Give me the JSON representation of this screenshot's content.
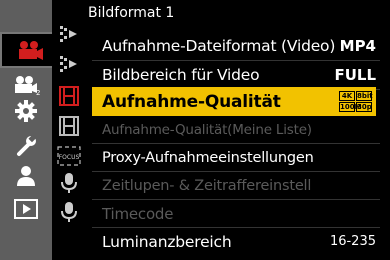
{
  "header": {
    "title": "Bildformat 1"
  },
  "menu": {
    "items": [
      {
        "label": "Aufnahme-Dateiformat (Video)",
        "value": "MP4"
      },
      {
        "label": "Bildbereich für Video",
        "value": "FULL"
      },
      {
        "label": "Aufnahme-Qualität",
        "badge": [
          "4K",
          "8bit",
          "100M",
          "30p"
        ]
      },
      {
        "label": "Aufnahme-Qualität(Meine Liste)"
      },
      {
        "label": "Proxy-Aufnahmeeinstellungen"
      },
      {
        "label": "Zeitlupen- & Zeitraffereinstell"
      },
      {
        "label": "Timecode"
      },
      {
        "label": "Luminanzbereich",
        "value": "16-235"
      }
    ]
  },
  "subtabs": {
    "focus_label": "FOCUS"
  },
  "colors": {
    "highlight": "#f2c200",
    "active_tab": "#d21e1e",
    "sidebar": "#5e5e5e"
  },
  "icons": {
    "main_tabs": [
      "video-camera-icon",
      "video-camera-2-icon",
      "gear-icon",
      "wrench-icon",
      "person-icon",
      "playback-icon"
    ],
    "sub_tabs": [
      "image-format-icon",
      "image-format-2-icon",
      "film-strip-icon",
      "film-strip-outline-icon",
      "focus-icon",
      "microphone-icon",
      "microphone-2-icon"
    ]
  }
}
